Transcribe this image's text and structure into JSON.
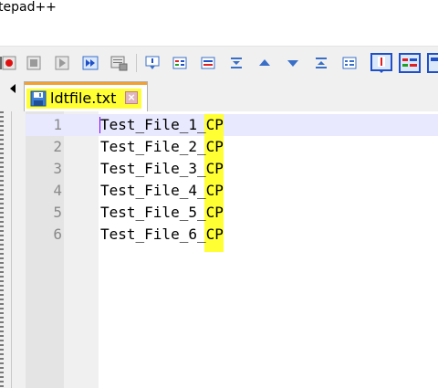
{
  "app": {
    "title": "tepad++"
  },
  "tab": {
    "filename": "ldtfile.txt",
    "close_glyph": "×"
  },
  "editor": {
    "line_numbers": [
      "1",
      "2",
      "3",
      "4",
      "5",
      "6"
    ],
    "lines": [
      {
        "pre": "Test_File_",
        "num": "1",
        "post": "_CP"
      },
      {
        "pre": "Test_File_",
        "num": "2",
        "post": "_CP"
      },
      {
        "pre": "Test_File_",
        "num": "3",
        "post": "_CP"
      },
      {
        "pre": "Test_File_",
        "num": "4",
        "post": "_CP"
      },
      {
        "pre": "Test_File_",
        "num": "5",
        "post": "_CP"
      },
      {
        "pre": "Test_File_",
        "num": "6",
        "post": "_CP"
      }
    ]
  },
  "colors": {
    "highlight_yellow": "#ffff33",
    "tab_accent": "#f3a030",
    "caret": "#8000ff",
    "current_line": "#e8e8ff"
  },
  "toolbar": {
    "icons": [
      "sync-scroll-icon",
      "record-macro-icon",
      "stop-record-icon",
      "play-macro-icon",
      "run-multiple-macro-icon",
      "save-macro-icon",
      "go-to-icon",
      "column-mode-icon",
      "mark-icon",
      "collapse-icon",
      "find-up-icon",
      "find-down-icon",
      "expand-icon",
      "list-icon",
      "document-map-icon",
      "function-list-icon"
    ]
  }
}
